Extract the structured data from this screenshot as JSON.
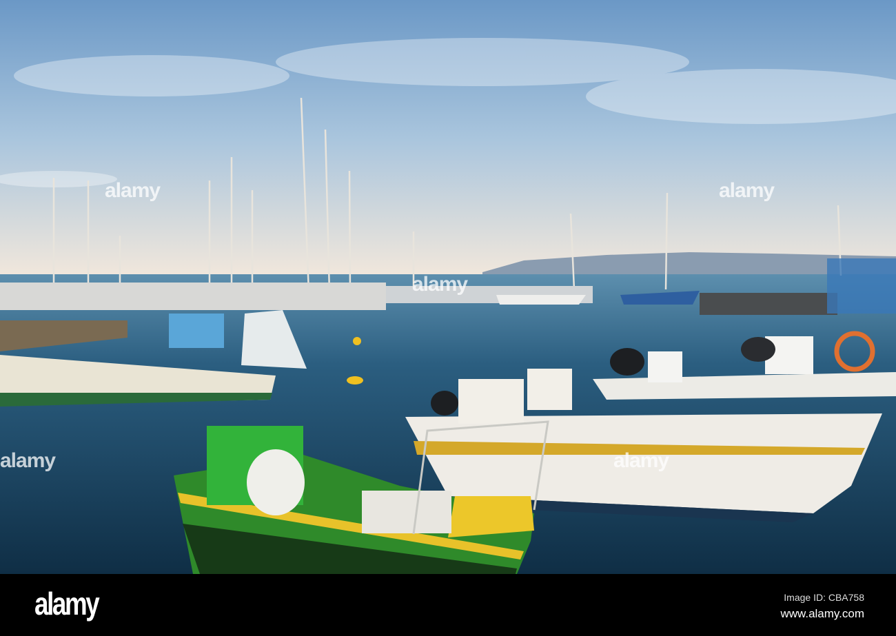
{
  "photo": {
    "subject": "Fishing boats and sailboats in harbour",
    "colors": {
      "sky_top": "#6f9cc9",
      "sky_horizon": "#efe6dc",
      "water": "#1e4a6a",
      "green_boat": "#2f8a2a",
      "yellow": "#e8c22a"
    }
  },
  "watermark": {
    "text": "alamy"
  },
  "footer": {
    "logo": "alamy",
    "image_id": "Image ID: CBA758",
    "website": "www.alamy.com"
  }
}
